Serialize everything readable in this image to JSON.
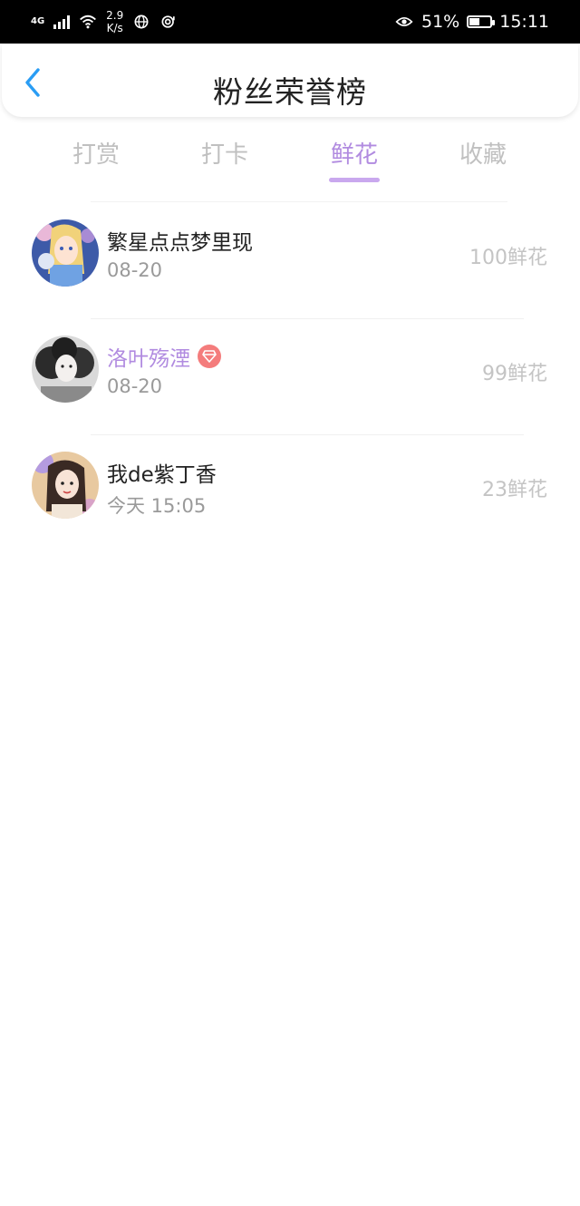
{
  "status_bar": {
    "network": "4G",
    "speed_value": "2.9",
    "speed_unit": "K/s",
    "battery_percent": "51%",
    "battery_level": 0.51,
    "time": "15:11"
  },
  "header": {
    "title": "粉丝荣誉榜",
    "back_icon": "chevron-left-icon",
    "back_color": "#2a9df4"
  },
  "tabs": [
    {
      "label": "打赏",
      "active": false
    },
    {
      "label": "打卡",
      "active": false
    },
    {
      "label": "鲜花",
      "active": true
    },
    {
      "label": "收藏",
      "active": false
    }
  ],
  "accent_color": "#b18be0",
  "fans": [
    {
      "name": "繁星点点梦里现",
      "date": "08-20",
      "count": "100鲜花",
      "vip": false
    },
    {
      "name": "洛叶殇湮",
      "date": "08-20",
      "count": "99鲜花",
      "vip": true
    },
    {
      "name": "我de紫丁香",
      "date": "今天 15:05",
      "count": "23鲜花",
      "vip": false
    }
  ]
}
